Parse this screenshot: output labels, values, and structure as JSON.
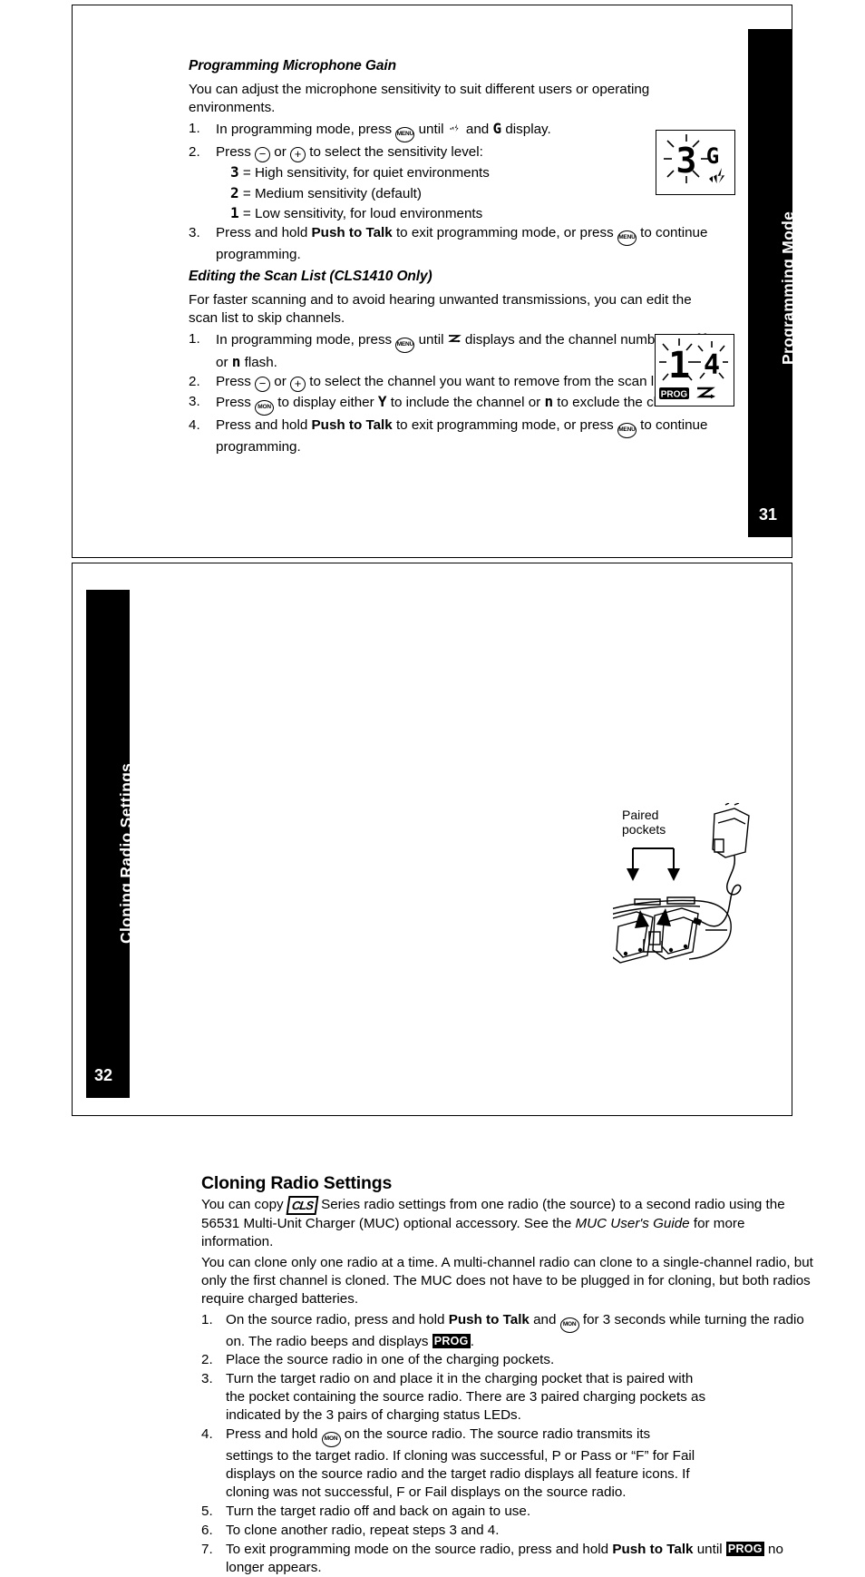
{
  "pages": [
    {
      "tab_label": "Programming Mode",
      "page_number": "31",
      "sections": [
        {
          "heading": "Programming Microphone Gain",
          "intro": "You can adjust the microphone sensitivity to suit different users or operating environments.",
          "steps": [
            {
              "num": "1.",
              "text_a": "In programming mode, press ",
              "key": "MENU",
              "text_b": " until ",
              "glyph_a": "mic-icon",
              "text_c": " and ",
              "glyph_b": "G",
              "text_d": " display."
            },
            {
              "num": "2.",
              "text_a": "Press ",
              "key": "minus",
              "text_b": " or ",
              "key2": "plus",
              "text_c": " to select the sensitivity level:"
            },
            {
              "num": "3.",
              "text_a": "Press and hold ",
              "bold": "Push to Talk",
              "text_b": " to exit programming mode, or press ",
              "key": "MENU",
              "text_c": " to continue programming."
            }
          ],
          "sensitivity_levels": [
            {
              "glyph": "3",
              "label": "= High sensitivity, for quiet environments"
            },
            {
              "glyph": "2",
              "label": "= Medium sensitivity (default)"
            },
            {
              "glyph": "1",
              "label": "= Low sensitivity, for loud environments"
            }
          ]
        },
        {
          "heading": "Editing the Scan List (CLS1410 Only)",
          "intro": "For faster scanning and to avoid hearing unwanted transmissions, you can edit the scan list to skip channels.",
          "steps": [
            {
              "num": "1.",
              "text_a": "In programming mode, press ",
              "key": "MENU",
              "text_b": " until ",
              "glyph_a": "scan-icon",
              "text_c": " displays and the channel number and ",
              "glyph_b": "Y",
              "text_d": " or ",
              "glyph_c": "n",
              "text_e": " flash."
            },
            {
              "num": "2.",
              "text_a": "Press ",
              "key": "minus",
              "text_b": " or ",
              "key2": "plus",
              "text_c": " to select the channel you want to remove from the scan list."
            },
            {
              "num": "3.",
              "text_a": "Press ",
              "key": "MON",
              "text_b": " to display either ",
              "glyph_a": "Y",
              "text_c": " to include the channel or ",
              "glyph_b": "n",
              "text_d": " to exclude the channel."
            },
            {
              "num": "4.",
              "text_a": "Press and hold ",
              "bold": "Push to Talk",
              "text_b": " to exit programming mode, or press ",
              "key": "MENU",
              "text_c": " to continue programming."
            }
          ]
        }
      ],
      "lcd_displays": [
        {
          "name": "mic-gain-display",
          "digits": "3 G",
          "icons": [
            "flashing-digit",
            "mic-icon"
          ]
        },
        {
          "name": "scan-list-display",
          "digits": "1 4",
          "icons": [
            "flashing-digits",
            "PROG",
            "scan-icon"
          ]
        }
      ]
    },
    {
      "tab_label": "Cloning Radio Settings",
      "page_number": "32",
      "heading": "Cloning Radio Settings",
      "paragraphs": [
        {
          "a": "You can copy ",
          "logo": "CLS",
          "b": " Series radio settings from one radio (the source) to a second radio using the 56531 Multi-Unit Charger (MUC) optional accessory. See the ",
          "italic": "MUC User's Guide",
          "c": " for more information."
        },
        {
          "a": "You can clone only one radio at a time. A multi-channel radio can clone to a single-channel radio, but only the first channel is cloned. The MUC does not have to be plugged in for cloning, but both radios require charged batteries."
        }
      ],
      "steps": [
        {
          "num": "1.",
          "text_a": "On the source radio, press and hold ",
          "bold": "Push to Talk",
          "text_b": " and ",
          "key": "MON",
          "text_c": " for 3 seconds while turning the radio on. The radio beeps and displays ",
          "badge": "PROG",
          "text_d": "."
        },
        {
          "num": "2.",
          "text_a": "Place the source radio in one of the charging pockets."
        },
        {
          "num": "3.",
          "text_a": "Turn the target radio on and place it in the charging pocket that is paired with the pocket containing the source radio. There are 3 paired charging pockets as indicated by the 3 pairs of charging status LEDs."
        },
        {
          "num": "4.",
          "text_a": "Press and hold ",
          "key": "MON",
          "text_b": " on the source radio. The source radio transmits its settings to the target radio. If cloning was successful, P or Pass or “F” for Fail displays on the source radio and the target radio displays all feature icons. If cloning was not successful, F or Fail displays on the source radio."
        },
        {
          "num": "5.",
          "text_a": "Turn the target radio off and back on again to use."
        },
        {
          "num": "6.",
          "text_a": "To clone another radio, repeat steps 3 and 4."
        },
        {
          "num": "7.",
          "text_a": "To exit programming mode on the source radio, press and hold ",
          "bold": "Push to Talk",
          "text_b": " until ",
          "badge": "PROG",
          "text_c": " no longer appears."
        }
      ],
      "illustration": {
        "name": "multi-unit-charger-diagram",
        "label_line1": "Paired",
        "label_line2": "pockets"
      }
    }
  ],
  "colors": {
    "ink": "#000000",
    "paper": "#ffffff",
    "tab_bg": "#000000",
    "tab_text": "#ffffff"
  }
}
